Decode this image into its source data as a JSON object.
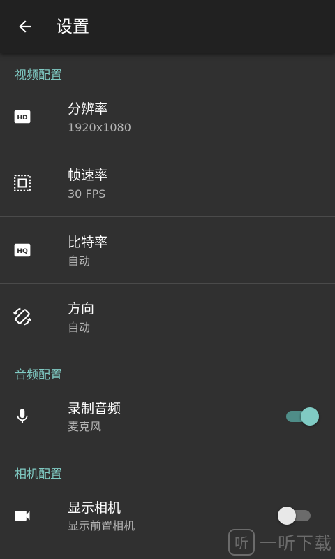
{
  "header": {
    "title": "设置"
  },
  "sections": {
    "video": "视频配置",
    "audio": "音频配置",
    "camera": "相机配置"
  },
  "video": {
    "resolution": {
      "title": "分辨率",
      "value": "1920x1080",
      "icon": "hd-icon"
    },
    "framerate": {
      "title": "帧速率",
      "value": "30 FPS",
      "icon": "frame-icon"
    },
    "bitrate": {
      "title": "比特率",
      "value": "自动",
      "icon": "hq-icon"
    },
    "orientation": {
      "title": "方向",
      "value": "自动",
      "icon": "rotate-icon"
    }
  },
  "audio": {
    "record": {
      "title": "录制音频",
      "value": "麦克风",
      "icon": "mic-icon",
      "enabled": true
    }
  },
  "camera": {
    "show": {
      "title": "显示相机",
      "value": "显示前置相机",
      "icon": "videocam-icon",
      "enabled": false
    }
  },
  "watermark": {
    "text": "一听下载",
    "logo": "听"
  },
  "colors": {
    "accent": "#80cbc4",
    "background": "#303030",
    "appbar": "#212121"
  }
}
